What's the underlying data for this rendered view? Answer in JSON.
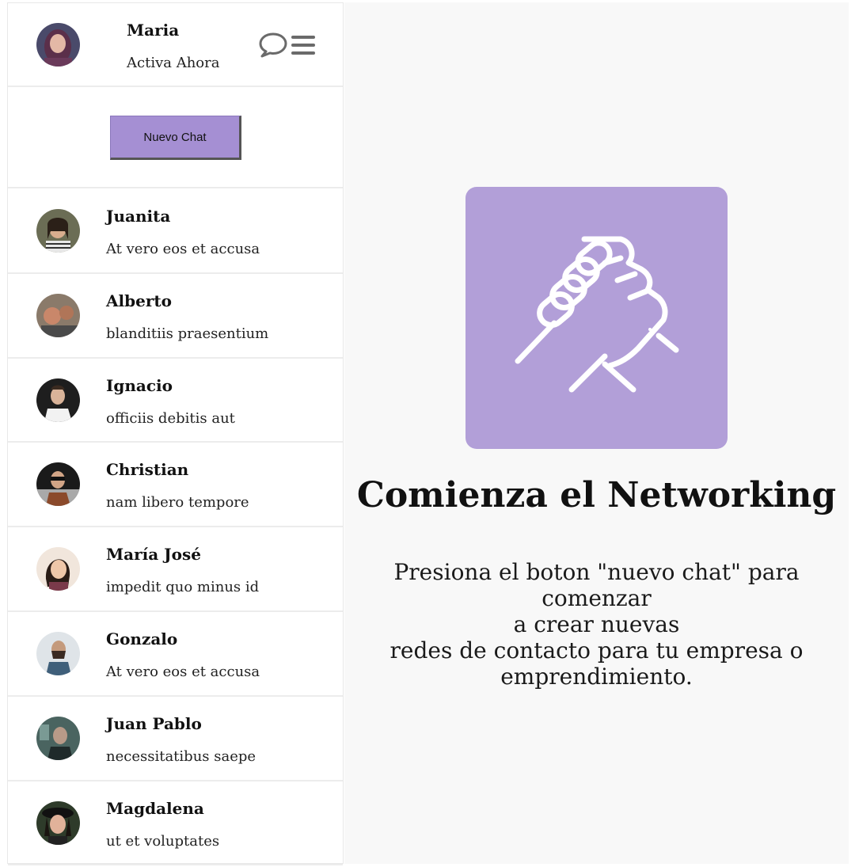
{
  "user": {
    "name": "Maria",
    "status": "Activa Ahora",
    "avatar_color": "#5b3a5c"
  },
  "new_chat_label": "Nuevo Chat",
  "contacts": [
    {
      "name": "Juanita",
      "message": "At vero eos et accusa",
      "avatar_color": "#6b6d55"
    },
    {
      "name": "Alberto",
      "message": "blanditiis praesentium",
      "avatar_color": "#8a6a5a"
    },
    {
      "name": "Ignacio",
      "message": "officiis debitis aut",
      "avatar_color": "#2a2a2a"
    },
    {
      "name": "Christian",
      "message": "nam libero tempore",
      "avatar_color": "#7a5340"
    },
    {
      "name": "María José",
      "message": "impedit quo minus id",
      "avatar_color": "#e9d9cc"
    },
    {
      "name": "Gonzalo",
      "message": "At vero eos et accusa",
      "avatar_color": "#8fa3b3"
    },
    {
      "name": "Juan Pablo",
      "message": "necessitatibus saepe",
      "avatar_color": "#3f5a55"
    },
    {
      "name": "Magdalena",
      "message": "ut et voluptates",
      "avatar_color": "#2e3b2a"
    }
  ],
  "main": {
    "title": "Comienza el Networking",
    "description_lines": [
      "Presiona el boton \"nuevo chat\" para comenzar",
      "a crear nuevas",
      "redes de contacto para tu empresa o",
      "emprendimiento."
    ],
    "icon": "handshake-icon"
  },
  "colors": {
    "accent": "#a58fd3",
    "hero_box": "#b29fd8",
    "main_bg": "#f8f8f8"
  }
}
